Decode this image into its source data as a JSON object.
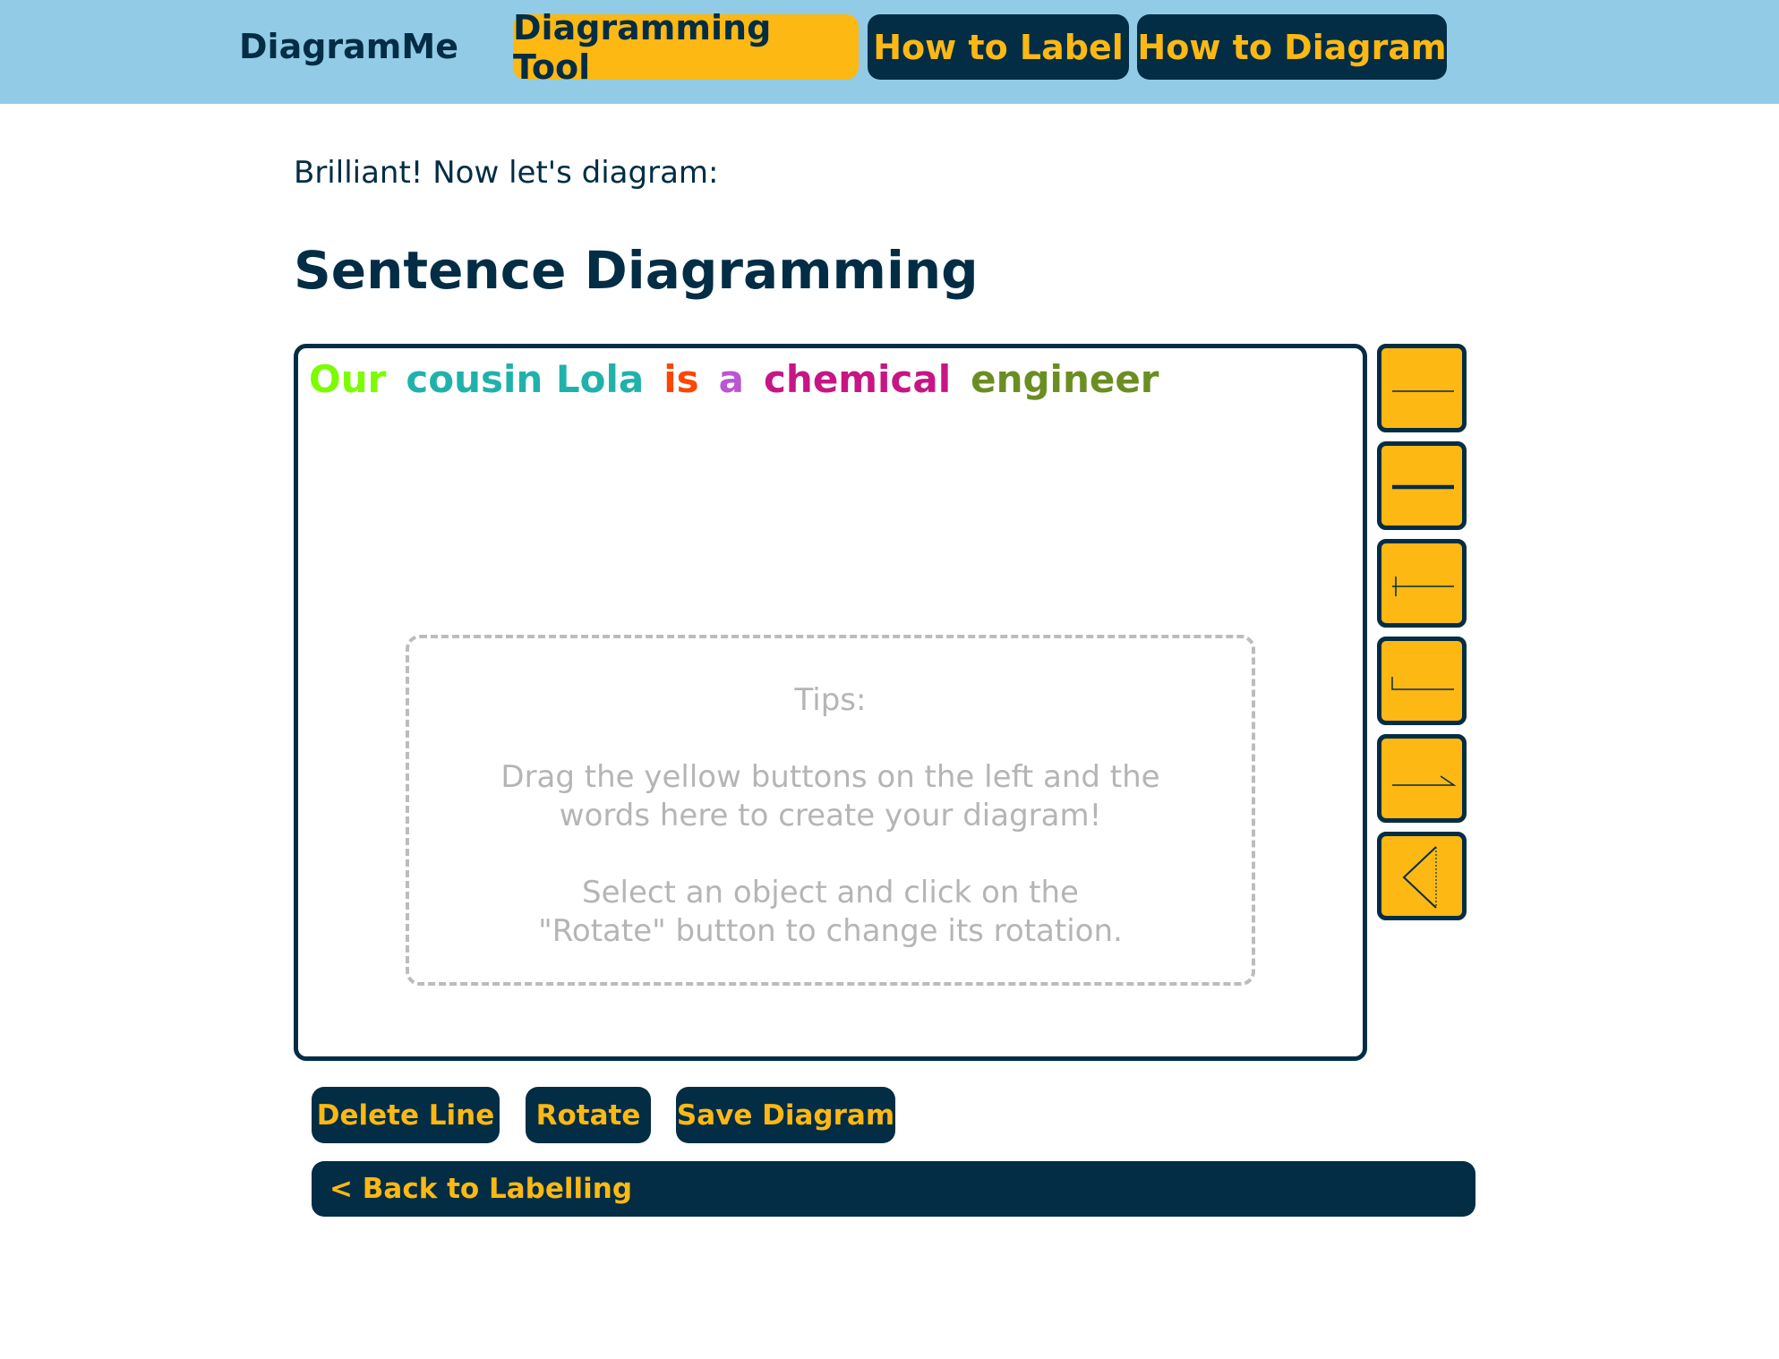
{
  "header": {
    "brand": "DiagramMe",
    "tabs": [
      {
        "label": "Diagramming Tool",
        "active": true
      },
      {
        "label": "How to Label",
        "active": false
      },
      {
        "label": "How to Diagram",
        "active": false
      }
    ]
  },
  "main": {
    "intro": "Brilliant! Now let's diagram:",
    "title": "Sentence Diagramming"
  },
  "canvas": {
    "words": [
      {
        "text": "Our",
        "color": "#7cfc00"
      },
      {
        "text": "cousin Lola",
        "color": "#20b2aa"
      },
      {
        "text": "is",
        "color": "#ff4500"
      },
      {
        "text": "a",
        "color": "#ba55d3"
      },
      {
        "text": "chemical",
        "color": "#c71585"
      },
      {
        "text": "engineer",
        "color": "#6b8e23"
      }
    ],
    "tips": {
      "title": "Tips:",
      "p1": "Drag the yellow buttons on the left and the words here to create your diagram!",
      "p2": "Select an object and click on the \"Rotate\" button to change its rotation."
    }
  },
  "tools": [
    {
      "icon": "thin-line-icon"
    },
    {
      "icon": "thick-line-icon"
    },
    {
      "icon": "divider-line-icon"
    },
    {
      "icon": "corner-line-icon"
    },
    {
      "icon": "slant-line-icon"
    },
    {
      "icon": "conjunction-bracket-icon"
    }
  ],
  "actions": {
    "delete_line": "Delete Line",
    "rotate": "Rotate",
    "save_diagram": "Save Diagram",
    "back": "< Back to Labelling"
  },
  "colors": {
    "navy": "#022d45",
    "yellow": "#fdb813",
    "header_bg": "#92cbe6"
  }
}
